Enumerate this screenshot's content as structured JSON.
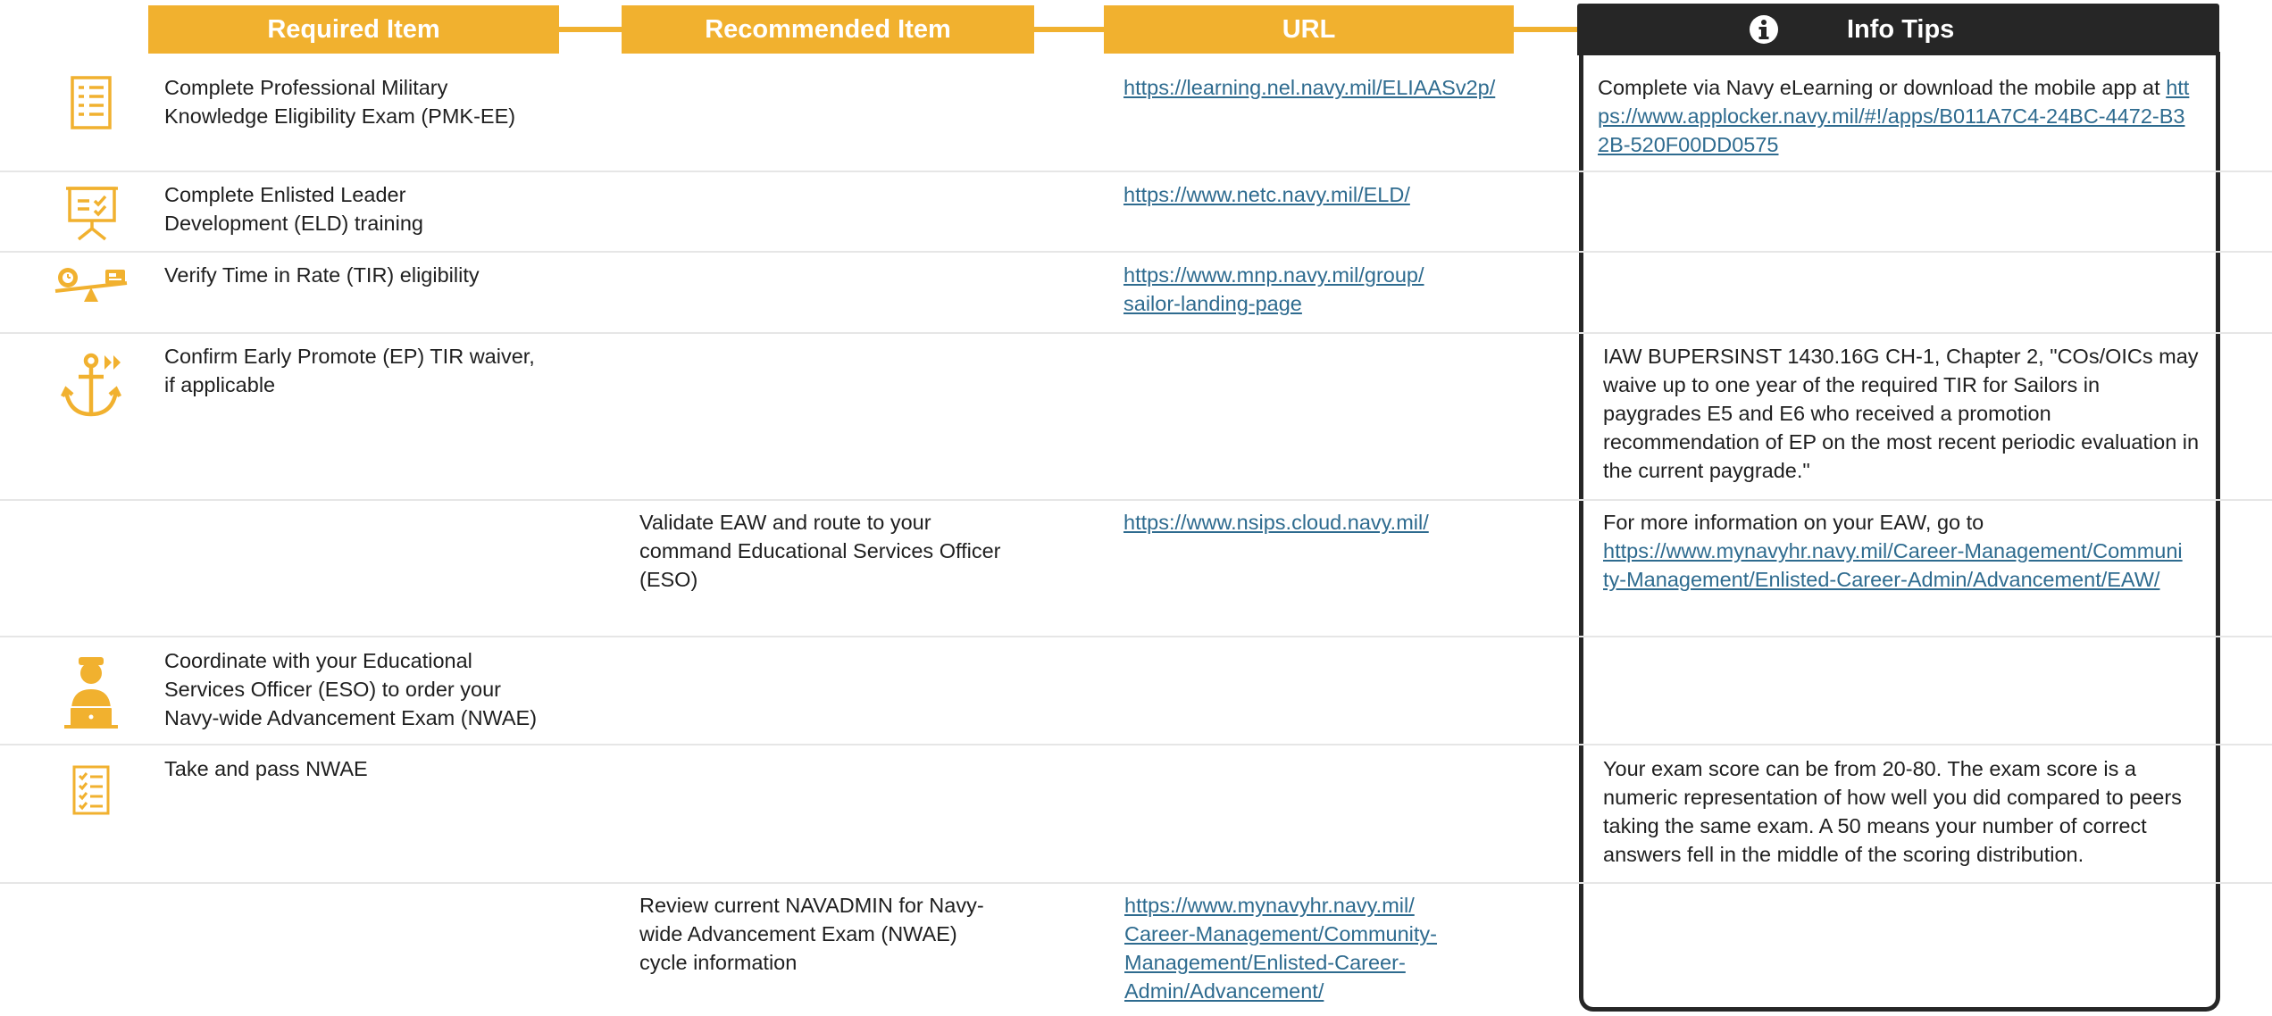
{
  "header": {
    "required": "Required Item",
    "recommended": "Recommended Item",
    "url": "URL",
    "tips": "Info Tips"
  },
  "colors": {
    "accent": "#f1b12f",
    "link": "#2e6b8f",
    "tips_border": "#262626",
    "row_separator": "#e6e6e6"
  },
  "rows": [
    {
      "icon": "exam-document-icon",
      "required": "Complete Professional Military\nKnowledge Eligibility Exam (PMK-EE)",
      "recommended": "",
      "url": "https://learning.nel.navy.mil/ELIAASv2p/",
      "tip_text": "Complete via Navy eLearning or download the mobile app at",
      "tip_link": "https://www.applocker.navy.mil/#!/apps/B011A7C4-24BC-4472-B32B-520F00DD0575"
    },
    {
      "icon": "presentation-board-icon",
      "required": "Complete Enlisted Leader\nDevelopment (ELD) training",
      "recommended": "",
      "url": "https://www.netc.navy.mil/ELD/",
      "tip_text": "",
      "tip_link": ""
    },
    {
      "icon": "time-balance-icon",
      "required": "Verify Time in Rate (TIR) eligibility",
      "recommended": "",
      "url": "https://www.mnp.navy.mil/group/\nsailor-landing-page",
      "tip_text": "",
      "tip_link": ""
    },
    {
      "icon": "anchor-icon",
      "required": "Confirm Early Promote (EP) TIR waiver,\nif applicable",
      "recommended": "",
      "url": "",
      "tip_text": "IAW BUPERSINST 1430.16G CH-1, Chapter 2, \"COs/OICs may waive up to one year of the required TIR for Sailors in paygrades E5 and E6 who received a promotion recommendation of EP on the most recent periodic evaluation in the current paygrade.\"",
      "tip_link": ""
    },
    {
      "icon": "",
      "required": "",
      "recommended": "Validate EAW and route to your\ncommand Educational Services Officer\n(ESO)",
      "url": "https://www.nsips.cloud.navy.mil/",
      "tip_text": "For more information on your EAW, go to",
      "tip_link": "https://www.mynavyhr.navy.mil/Career-Management/Community-Management/Enlisted-Career-Admin/Advancement/EAW/"
    },
    {
      "icon": "sailor-laptop-icon",
      "required": "Coordinate with your Educational\nServices Officer (ESO) to order your\nNavy-wide Advancement Exam (NWAE)",
      "recommended": "",
      "url": "",
      "tip_text": "",
      "tip_link": ""
    },
    {
      "icon": "checklist-icon",
      "required": "Take and pass NWAE",
      "recommended": "",
      "url": "",
      "tip_text": "Your exam score can be from 20-80. The exam score is a numeric representation of how well you did compared to peers taking the same exam. A 50 means your number of correct answers fell in the middle of the scoring distribution.",
      "tip_link": ""
    },
    {
      "icon": "",
      "required": "",
      "recommended": "Review current NAVADMIN for Navy-\nwide Advancement Exam (NWAE)\ncycle information",
      "url": "https://www.mynavyhr.navy.mil/\nCareer-Management/Community-\nManagement/Enlisted-Career-\nAdmin/Advancement/",
      "tip_text": "",
      "tip_link": ""
    }
  ]
}
